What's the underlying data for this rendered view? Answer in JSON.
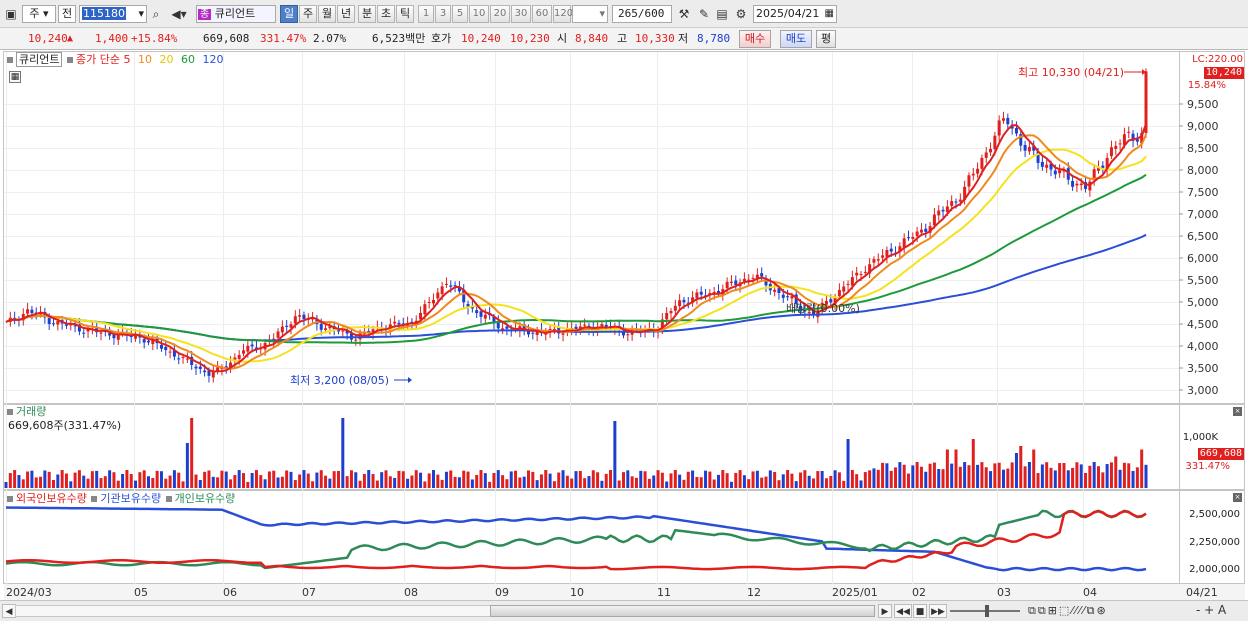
{
  "toolbar": {
    "market_type": "주",
    "market_scope": "전",
    "code": "115180",
    "stock_badge": "종",
    "stock_name": "큐리언트",
    "periods": [
      "일",
      "주",
      "월",
      "년",
      "분",
      "초",
      "틱"
    ],
    "selected_period": "일",
    "intervals": [
      "1",
      "3",
      "5",
      "10",
      "20",
      "30",
      "60",
      "120"
    ],
    "count": "265",
    "count_total": "/600",
    "date": "2025/04/21"
  },
  "quote": {
    "price": "10,240",
    "change_arrow": "▲",
    "change": "1,400",
    "change_pct": "+15.84%",
    "volume": "669,608",
    "volume_ratio": "331.47%",
    "turnover": "2.07%",
    "amount": "6,523백만",
    "ask_label": "호가",
    "ask": "10,240",
    "bid": "10,230",
    "open_label": "시",
    "open": "8,840",
    "high_label": "고",
    "high": "10,330",
    "low_label": "저",
    "low": "8,780",
    "buy_btn": "매수",
    "sell_btn": "매도",
    "extra_btn": "평"
  },
  "price_panel": {
    "legend_name": "큐리언트",
    "legend_series": "종가 단순",
    "ma_labels": [
      "5",
      "10",
      "20",
      "60",
      "120"
    ],
    "lc_label": "LC:220.00",
    "last_price": "10,240",
    "last_pct": "15.84%",
    "high_annotation": "최고 10,330 (04/21)",
    "low_annotation": "최저 3,200 (08/05)",
    "dividend_annotation": "배당락(0.00%)",
    "y_ticks": [
      "9,500",
      "9,000",
      "8,500",
      "8,000",
      "7,500",
      "7,000",
      "6,500",
      "6,000",
      "5,500",
      "5,000",
      "4,500",
      "4,000",
      "3,500",
      "3,000"
    ]
  },
  "volume_panel": {
    "title": "거래량",
    "value_label": "669,608주(331.47%)",
    "y_tick": "1,000K",
    "last_value": "669,608",
    "last_pct": "331.47%"
  },
  "holding_panel": {
    "series": [
      "외국인보유수량",
      "기관보유수량",
      "개인보유수량"
    ],
    "y_ticks": [
      "2,500,000",
      "2,250,000",
      "2,000,000"
    ]
  },
  "x_axis": {
    "labels": [
      "2024/03",
      "05",
      "06",
      "07",
      "08",
      "09",
      "10",
      "11",
      "12",
      "2025/01",
      "02",
      "03",
      "04",
      "04/21"
    ]
  },
  "colors": {
    "up": "#e0201e",
    "down": "#1c3fd0",
    "ma5": "#e0201e",
    "ma10": "#f08a1c",
    "ma20": "#f5e21e",
    "ma60": "#1f9a3a",
    "ma120": "#2a4fd6",
    "foreign": "#e0201e",
    "institution": "#2a4fd6",
    "individual": "#2e8b57"
  },
  "scroll_controls": [
    "▶",
    "|◀◀",
    "■",
    "▶▶",
    "- + A"
  ],
  "icons": [
    "window-icon",
    "dropdown-icon",
    "search-icon",
    "speaker-icon",
    "chart-tools-icon",
    "save-icon",
    "settings-icon",
    "calendar-icon",
    "grid-icon",
    "close-icon"
  ]
}
